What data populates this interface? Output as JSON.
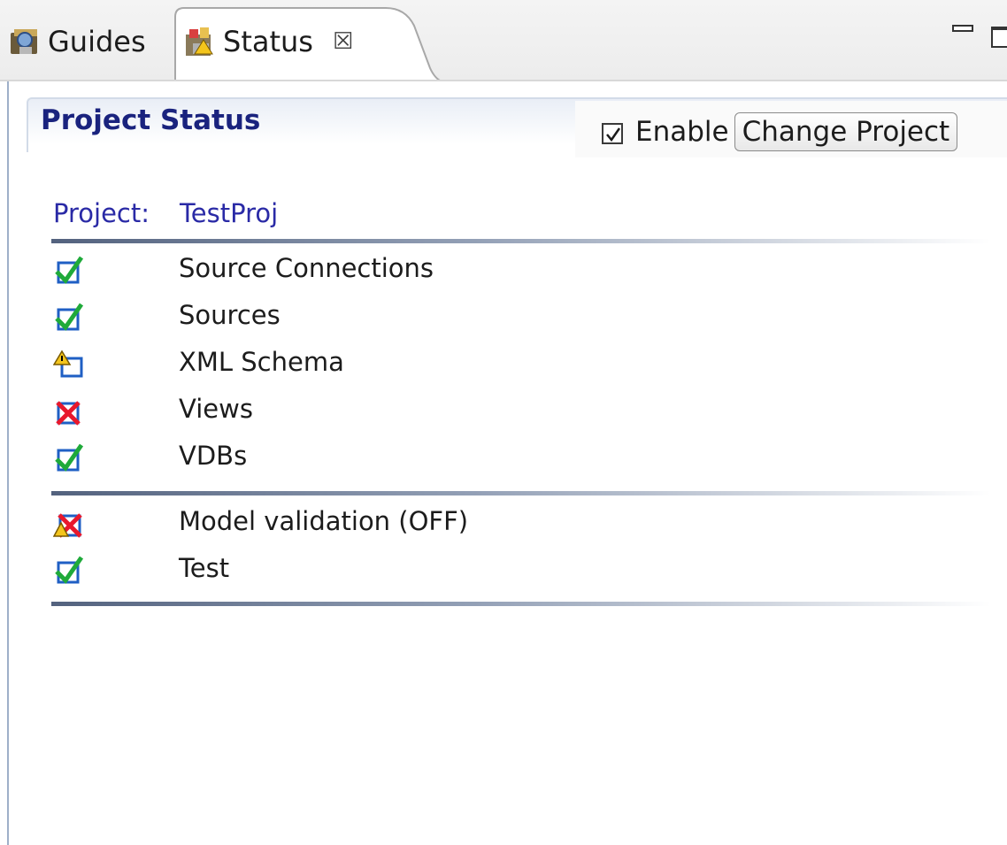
{
  "tabs": {
    "guides_label": "Guides",
    "status_label": "Status",
    "close_glyph": "☒"
  },
  "header": {
    "title": "Project Status",
    "enable_label": "Enable",
    "enable_checked": true,
    "change_project_label": "Change Project"
  },
  "project": {
    "label": "Project:",
    "name": "TestProj"
  },
  "status_items": [
    {
      "label": "Source Connections",
      "status": "ok",
      "icon": "check-icon"
    },
    {
      "label": "Sources",
      "status": "ok",
      "icon": "check-icon"
    },
    {
      "label": "XML Schema",
      "status": "warning",
      "icon": "warning-box-icon"
    },
    {
      "label": "Views",
      "status": "error",
      "icon": "error-x-icon"
    },
    {
      "label": "VDBs",
      "status": "ok",
      "icon": "check-icon"
    },
    {
      "label": "Model validation (OFF)",
      "status": "off",
      "icon": "warning-x-icon"
    },
    {
      "label": "Test",
      "status": "ok",
      "icon": "check-icon"
    }
  ],
  "colors": {
    "title": "#1a237e",
    "project_text": "#2a2aa6",
    "ok_check": "#1faa3a",
    "error_x": "#e8182c",
    "warning": "#f4c51c"
  }
}
